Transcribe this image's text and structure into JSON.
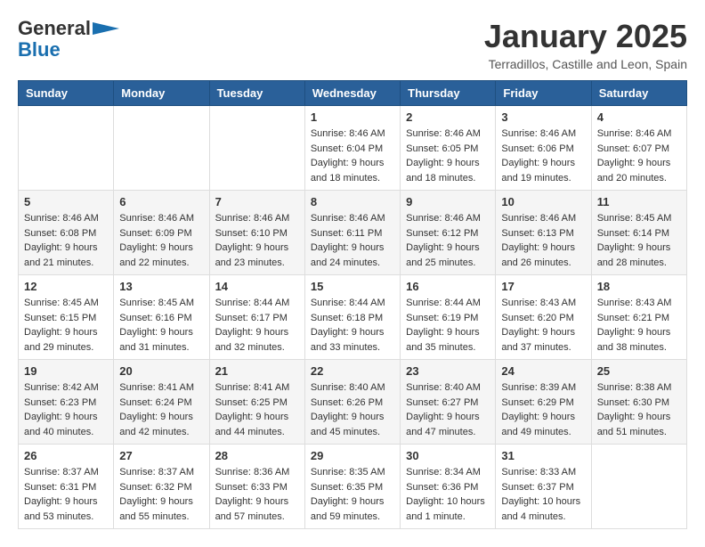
{
  "header": {
    "logo_line1": "General",
    "logo_line2": "Blue",
    "month_title": "January 2025",
    "location": "Terradillos, Castille and Leon, Spain"
  },
  "weekdays": [
    "Sunday",
    "Monday",
    "Tuesday",
    "Wednesday",
    "Thursday",
    "Friday",
    "Saturday"
  ],
  "weeks": [
    [
      {
        "day": "",
        "info": ""
      },
      {
        "day": "",
        "info": ""
      },
      {
        "day": "",
        "info": ""
      },
      {
        "day": "1",
        "info": "Sunrise: 8:46 AM\nSunset: 6:04 PM\nDaylight: 9 hours\nand 18 minutes."
      },
      {
        "day": "2",
        "info": "Sunrise: 8:46 AM\nSunset: 6:05 PM\nDaylight: 9 hours\nand 18 minutes."
      },
      {
        "day": "3",
        "info": "Sunrise: 8:46 AM\nSunset: 6:06 PM\nDaylight: 9 hours\nand 19 minutes."
      },
      {
        "day": "4",
        "info": "Sunrise: 8:46 AM\nSunset: 6:07 PM\nDaylight: 9 hours\nand 20 minutes."
      }
    ],
    [
      {
        "day": "5",
        "info": "Sunrise: 8:46 AM\nSunset: 6:08 PM\nDaylight: 9 hours\nand 21 minutes."
      },
      {
        "day": "6",
        "info": "Sunrise: 8:46 AM\nSunset: 6:09 PM\nDaylight: 9 hours\nand 22 minutes."
      },
      {
        "day": "7",
        "info": "Sunrise: 8:46 AM\nSunset: 6:10 PM\nDaylight: 9 hours\nand 23 minutes."
      },
      {
        "day": "8",
        "info": "Sunrise: 8:46 AM\nSunset: 6:11 PM\nDaylight: 9 hours\nand 24 minutes."
      },
      {
        "day": "9",
        "info": "Sunrise: 8:46 AM\nSunset: 6:12 PM\nDaylight: 9 hours\nand 25 minutes."
      },
      {
        "day": "10",
        "info": "Sunrise: 8:46 AM\nSunset: 6:13 PM\nDaylight: 9 hours\nand 26 minutes."
      },
      {
        "day": "11",
        "info": "Sunrise: 8:45 AM\nSunset: 6:14 PM\nDaylight: 9 hours\nand 28 minutes."
      }
    ],
    [
      {
        "day": "12",
        "info": "Sunrise: 8:45 AM\nSunset: 6:15 PM\nDaylight: 9 hours\nand 29 minutes."
      },
      {
        "day": "13",
        "info": "Sunrise: 8:45 AM\nSunset: 6:16 PM\nDaylight: 9 hours\nand 31 minutes."
      },
      {
        "day": "14",
        "info": "Sunrise: 8:44 AM\nSunset: 6:17 PM\nDaylight: 9 hours\nand 32 minutes."
      },
      {
        "day": "15",
        "info": "Sunrise: 8:44 AM\nSunset: 6:18 PM\nDaylight: 9 hours\nand 33 minutes."
      },
      {
        "day": "16",
        "info": "Sunrise: 8:44 AM\nSunset: 6:19 PM\nDaylight: 9 hours\nand 35 minutes."
      },
      {
        "day": "17",
        "info": "Sunrise: 8:43 AM\nSunset: 6:20 PM\nDaylight: 9 hours\nand 37 minutes."
      },
      {
        "day": "18",
        "info": "Sunrise: 8:43 AM\nSunset: 6:21 PM\nDaylight: 9 hours\nand 38 minutes."
      }
    ],
    [
      {
        "day": "19",
        "info": "Sunrise: 8:42 AM\nSunset: 6:23 PM\nDaylight: 9 hours\nand 40 minutes."
      },
      {
        "day": "20",
        "info": "Sunrise: 8:41 AM\nSunset: 6:24 PM\nDaylight: 9 hours\nand 42 minutes."
      },
      {
        "day": "21",
        "info": "Sunrise: 8:41 AM\nSunset: 6:25 PM\nDaylight: 9 hours\nand 44 minutes."
      },
      {
        "day": "22",
        "info": "Sunrise: 8:40 AM\nSunset: 6:26 PM\nDaylight: 9 hours\nand 45 minutes."
      },
      {
        "day": "23",
        "info": "Sunrise: 8:40 AM\nSunset: 6:27 PM\nDaylight: 9 hours\nand 47 minutes."
      },
      {
        "day": "24",
        "info": "Sunrise: 8:39 AM\nSunset: 6:29 PM\nDaylight: 9 hours\nand 49 minutes."
      },
      {
        "day": "25",
        "info": "Sunrise: 8:38 AM\nSunset: 6:30 PM\nDaylight: 9 hours\nand 51 minutes."
      }
    ],
    [
      {
        "day": "26",
        "info": "Sunrise: 8:37 AM\nSunset: 6:31 PM\nDaylight: 9 hours\nand 53 minutes."
      },
      {
        "day": "27",
        "info": "Sunrise: 8:37 AM\nSunset: 6:32 PM\nDaylight: 9 hours\nand 55 minutes."
      },
      {
        "day": "28",
        "info": "Sunrise: 8:36 AM\nSunset: 6:33 PM\nDaylight: 9 hours\nand 57 minutes."
      },
      {
        "day": "29",
        "info": "Sunrise: 8:35 AM\nSunset: 6:35 PM\nDaylight: 9 hours\nand 59 minutes."
      },
      {
        "day": "30",
        "info": "Sunrise: 8:34 AM\nSunset: 6:36 PM\nDaylight: 10 hours\nand 1 minute."
      },
      {
        "day": "31",
        "info": "Sunrise: 8:33 AM\nSunset: 6:37 PM\nDaylight: 10 hours\nand 4 minutes."
      },
      {
        "day": "",
        "info": ""
      }
    ]
  ]
}
